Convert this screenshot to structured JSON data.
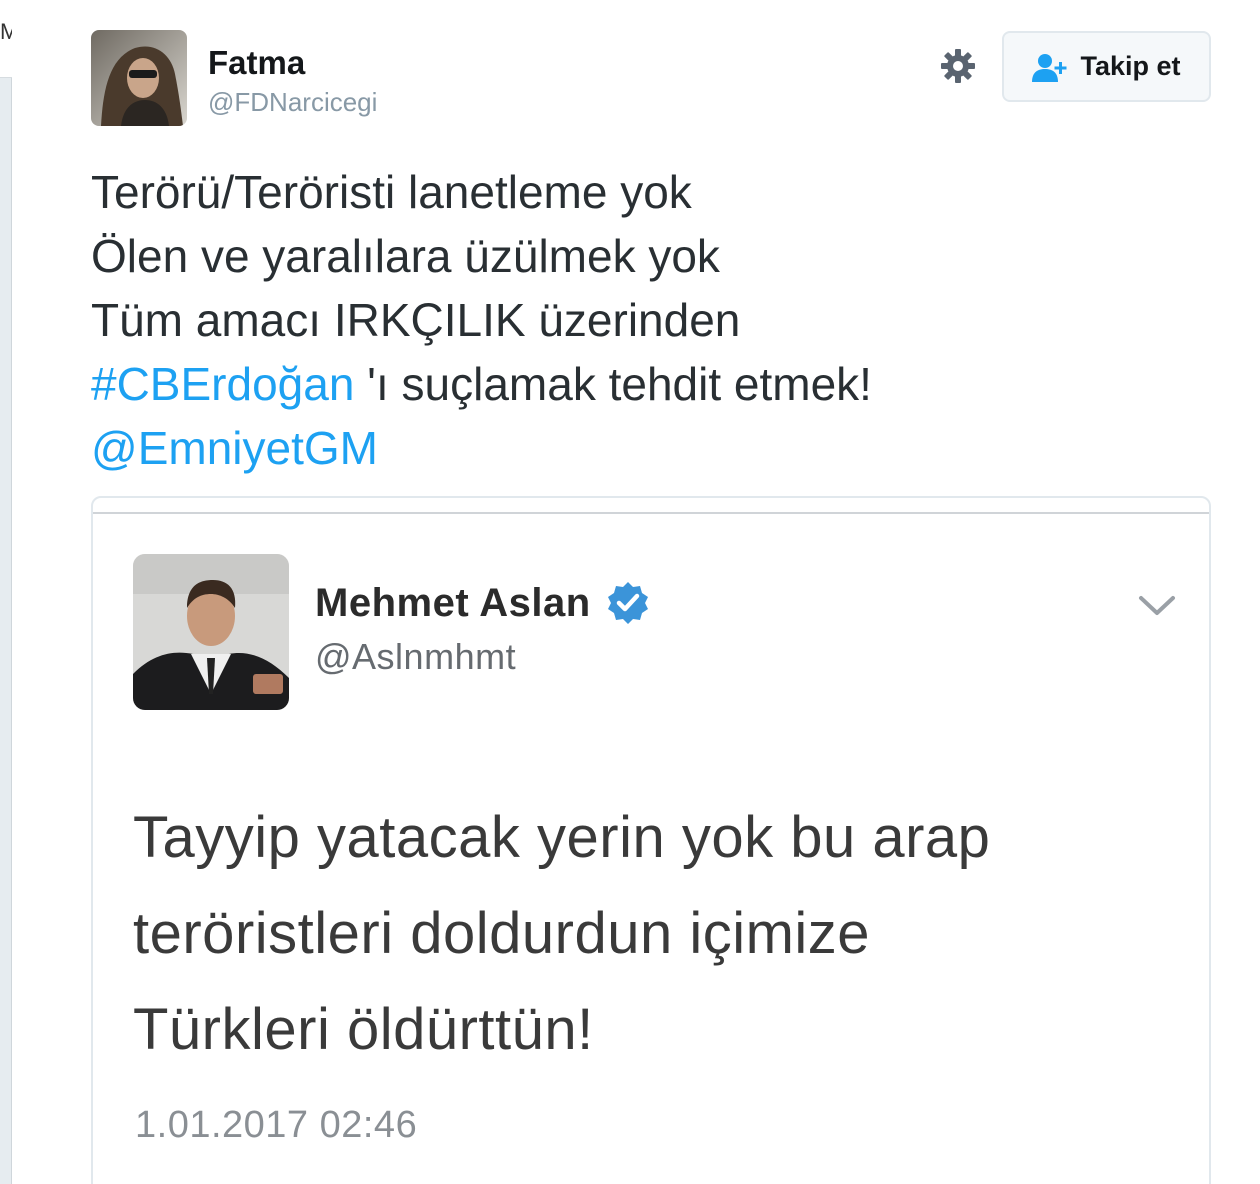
{
  "edge": {
    "char": "M"
  },
  "tweet": {
    "display_name": "Fatma",
    "handle": "@FDNarcicegi",
    "follow_label": "Takip et",
    "lines": [
      "Terörü/Teröristi lanetleme yok",
      "Ölen ve yaralılara üzülmek yok",
      "Tüm amacı IRKÇILIK üzerinden"
    ],
    "hashtag": "#CBErdoğan",
    "hashtag_suffix": " 'ı suçlamak tehdit etmek!",
    "mention": "@EmniyetGM"
  },
  "quoted": {
    "display_name": "Mehmet Aslan",
    "handle": "@Aslnmhmt",
    "text_lines": [
      "Tayyip yatacak yerin yok bu arap",
      "teröristleri doldurdun içimize",
      "Türkleri öldürttün!"
    ],
    "timestamp": "1.01.2017 02:46"
  },
  "icons": [
    "gear-icon",
    "follow-person-plus-icon",
    "verified-badge-icon",
    "chevron-down-icon"
  ],
  "colors": {
    "link": "#1da1f2",
    "verified": "#3b94d9",
    "muted": "#8899a6"
  }
}
